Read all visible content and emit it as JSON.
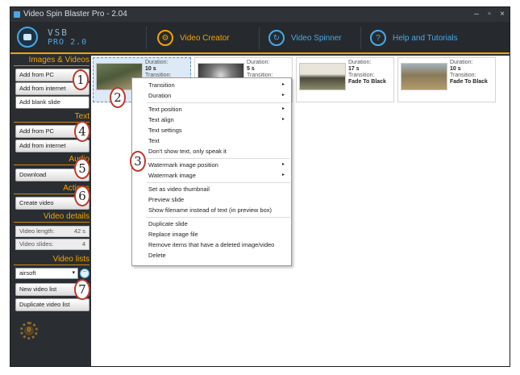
{
  "window": {
    "title": "Video Spin Blaster Pro - 2.04",
    "controls": [
      "–",
      "▫",
      "×"
    ]
  },
  "logo": {
    "line1": "VSB",
    "line2": "PRO 2.0"
  },
  "tabs": [
    {
      "label": "Video Creator",
      "icon": "gear-circle-icon",
      "glyph": "⚙",
      "color": "#f2a400"
    },
    {
      "label": "Video Spinner",
      "icon": "spin-arrows-icon",
      "glyph": "↻",
      "color": "#4aa8e8"
    },
    {
      "label": "Help and Tutorials",
      "icon": "question-circle-icon",
      "glyph": "?",
      "color": "#4aa8e8"
    }
  ],
  "sidebar": {
    "images": {
      "title": "Images & Videos",
      "buttons": [
        "Add from PC",
        "Add from internet",
        "Add blank slide"
      ]
    },
    "text": {
      "title": "Text",
      "buttons": [
        "Add from PC",
        "Add from internet"
      ]
    },
    "audio": {
      "title": "Audio",
      "buttons": [
        "Download"
      ]
    },
    "actions": {
      "title": "Actions",
      "buttons": [
        "Create video"
      ]
    },
    "details": {
      "title": "Video details",
      "length_label": "Video length:",
      "length_value": "42 s",
      "slides_label": "Video slides:",
      "slides_value": "4"
    },
    "lists": {
      "title": "Video lists",
      "selected": "airsoft",
      "buttons": [
        "New video list",
        "Duplicate video list"
      ]
    },
    "gear_value": "0"
  },
  "slides": [
    {
      "duration_label": "Duration:",
      "duration": "10 s",
      "transition_label": "Transition:",
      "transition": ""
    },
    {
      "duration_label": "Duration:",
      "duration": "5 s",
      "transition_label": "Transition:",
      "transition": ""
    },
    {
      "duration_label": "Duration:",
      "duration": "17 s",
      "transition_label": "Transition:",
      "transition": "Fade To Black"
    },
    {
      "duration_label": "Duration:",
      "duration": "10 s",
      "transition_label": "Transition:",
      "transition": "Fade To Black"
    }
  ],
  "context_menu": {
    "items": [
      {
        "label": "Transition",
        "submenu": "▸"
      },
      {
        "label": "Duration",
        "submenu": "▸"
      },
      {
        "label": "Text position",
        "submenu": "▸"
      },
      {
        "label": "Text align",
        "submenu": "▸"
      },
      {
        "label": "Text settings",
        "submenu": ""
      },
      {
        "label": "Text",
        "submenu": ""
      },
      {
        "label": "Don't show text, only speak it",
        "submenu": ""
      },
      {
        "label": "Watermark image position",
        "submenu": "▸"
      },
      {
        "label": "Watermark image",
        "submenu": "▸"
      },
      {
        "label": "Set as video thumbnail",
        "submenu": ""
      },
      {
        "label": "Preview slide",
        "submenu": ""
      },
      {
        "label": "Show filename instead of text (in preview box)",
        "submenu": ""
      },
      {
        "label": "Duplicate slide",
        "submenu": ""
      },
      {
        "label": "Replace image file",
        "submenu": ""
      },
      {
        "label": "Remove items that have a deleted image/video",
        "submenu": ""
      },
      {
        "label": "Delete",
        "submenu": ""
      }
    ]
  },
  "callouts": [
    "1",
    "2",
    "3",
    "4",
    "5",
    "6",
    "7"
  ],
  "colors": {
    "accent": "#f2a400",
    "blue": "#4aa8e8",
    "callout_border": "#c0392b",
    "selection": "#dce9f6"
  }
}
